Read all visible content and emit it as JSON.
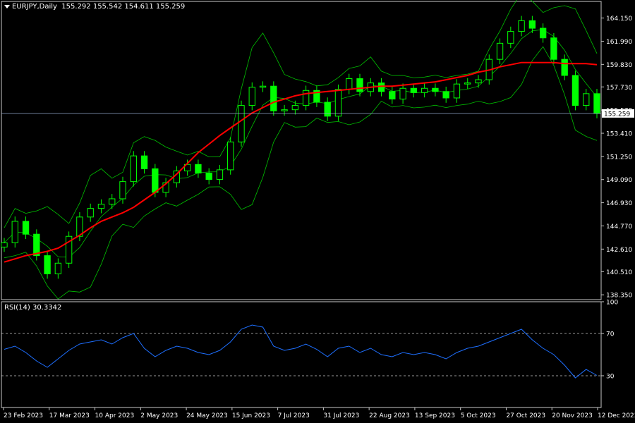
{
  "header": {
    "symbol": "EURJPY,Daily",
    "ohlc": "155.292 155.542 154.611 155.259"
  },
  "rsi_header": "RSI(14) 30.3342",
  "current_price": "155.259",
  "colors": {
    "background": "#000000",
    "candles": "#00ff00",
    "bands": "#00c000",
    "ma": "#ff0000",
    "rsi_line": "#1e6fff",
    "price_line": "#8fa3c9",
    "axis_text": "#ffffff"
  },
  "chart_data": [
    {
      "type": "line",
      "name": "EURJPY Daily",
      "indicators": [
        "Bollinger Bands",
        "Moving Average"
      ],
      "yticks": [
        "164.150",
        "161.990",
        "159.830",
        "157.730",
        "155.570",
        "153.410",
        "151.250",
        "149.090",
        "146.930",
        "144.770",
        "142.610",
        "140.510",
        "138.350"
      ],
      "ylim": [
        137.9,
        165.7
      ],
      "xticks": [
        "23 Feb 2023",
        "17 Mar 2023",
        "10 Apr 2023",
        "2 May 2023",
        "24 May 2023",
        "15 Jun 2023",
        "7 Jul 2023",
        "31 Jul 2023",
        "22 Aug 2023",
        "13 Sep 2023",
        "5 Oct 2023",
        "27 Oct 2023",
        "20 Nov 2023",
        "12 Dec 2023"
      ],
      "series": [
        {
          "name": "Close",
          "values": [
            143.2,
            145.2,
            144.0,
            142.0,
            140.3,
            141.3,
            143.8,
            145.6,
            146.4,
            146.8,
            147.3,
            148.9,
            151.3,
            150.1,
            147.9,
            148.8,
            149.9,
            150.5,
            149.7,
            149.1,
            150.0,
            152.6,
            156.0,
            157.7,
            157.8,
            155.5,
            155.6,
            156.0,
            157.4,
            156.3,
            155.0,
            157.5,
            158.5,
            157.3,
            158.1,
            157.3,
            156.6,
            157.6,
            157.2,
            157.6,
            157.3,
            156.7,
            158.0,
            158.1,
            158.4,
            160.3,
            161.8,
            162.9,
            163.9,
            163.2,
            162.3,
            160.3,
            158.8,
            156.0,
            157.1,
            155.259
          ]
        },
        {
          "name": "Moving Average",
          "values": [
            141.4,
            141.7,
            142.0,
            142.2,
            142.4,
            142.7,
            143.3,
            143.9,
            144.6,
            145.2,
            145.6,
            146.0,
            146.5,
            147.2,
            147.9,
            148.7,
            149.6,
            150.6,
            151.6,
            152.4,
            153.2,
            153.9,
            154.6,
            155.3,
            155.8,
            156.3,
            156.6,
            156.9,
            157.1,
            157.2,
            157.3,
            157.4,
            157.5,
            157.6,
            157.7,
            157.8,
            157.8,
            157.9,
            158.0,
            158.1,
            158.2,
            158.4,
            158.6,
            158.8,
            159.1,
            159.3,
            159.6,
            159.8,
            160.0,
            160.0,
            160.0,
            160.0,
            159.9,
            159.9,
            159.9,
            159.8
          ]
        }
      ]
    },
    {
      "type": "line",
      "name": "RSI(14)",
      "ylim": [
        0,
        100
      ],
      "yticks": [
        "100",
        "70",
        "30",
        "0"
      ],
      "levels": [
        70,
        30
      ],
      "series": [
        {
          "name": "RSI(14)",
          "values": [
            55,
            58,
            52,
            44,
            38,
            46,
            54,
            60,
            62,
            64,
            60,
            66,
            70,
            56,
            48,
            54,
            58,
            56,
            52,
            50,
            54,
            62,
            74,
            78,
            76,
            58,
            54,
            56,
            60,
            55,
            48,
            56,
            58,
            52,
            56,
            50,
            48,
            52,
            50,
            52,
            50,
            46,
            52,
            56,
            58,
            62,
            66,
            70,
            74,
            64,
            56,
            50,
            40,
            28,
            36,
            30.3342
          ]
        }
      ]
    }
  ]
}
